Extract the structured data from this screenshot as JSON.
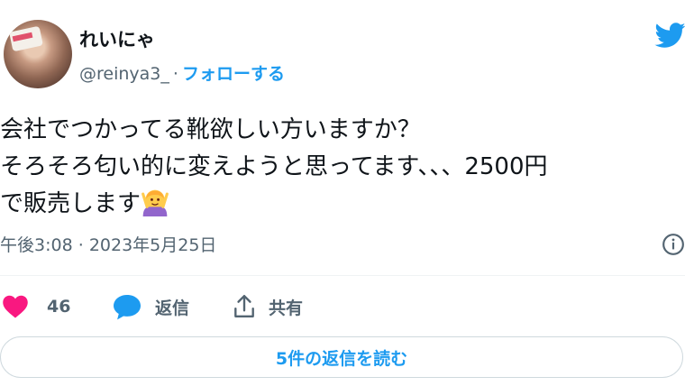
{
  "author": {
    "display_name": "れいにゃ",
    "handle": "@reinya3_",
    "separator": "·",
    "follow_label": "フォローする"
  },
  "tweet": {
    "lines": [
      "会社でつかってる靴欲しい方いますか？",
      "そろそろ匂い的に変えようと思ってます、、、2500円",
      "で販売します"
    ],
    "emoji": "person-gesturing-ok-emoji"
  },
  "meta": {
    "time": "午後3:08",
    "separator": "·",
    "date": "2023年5月25日"
  },
  "actions": {
    "like_count": "46",
    "reply_label": "返信",
    "share_label": "共有"
  },
  "read_replies_label": "5件の返信を読む",
  "colors": {
    "accent": "#1d9bf0",
    "like": "#f91880",
    "muted": "#536471"
  }
}
